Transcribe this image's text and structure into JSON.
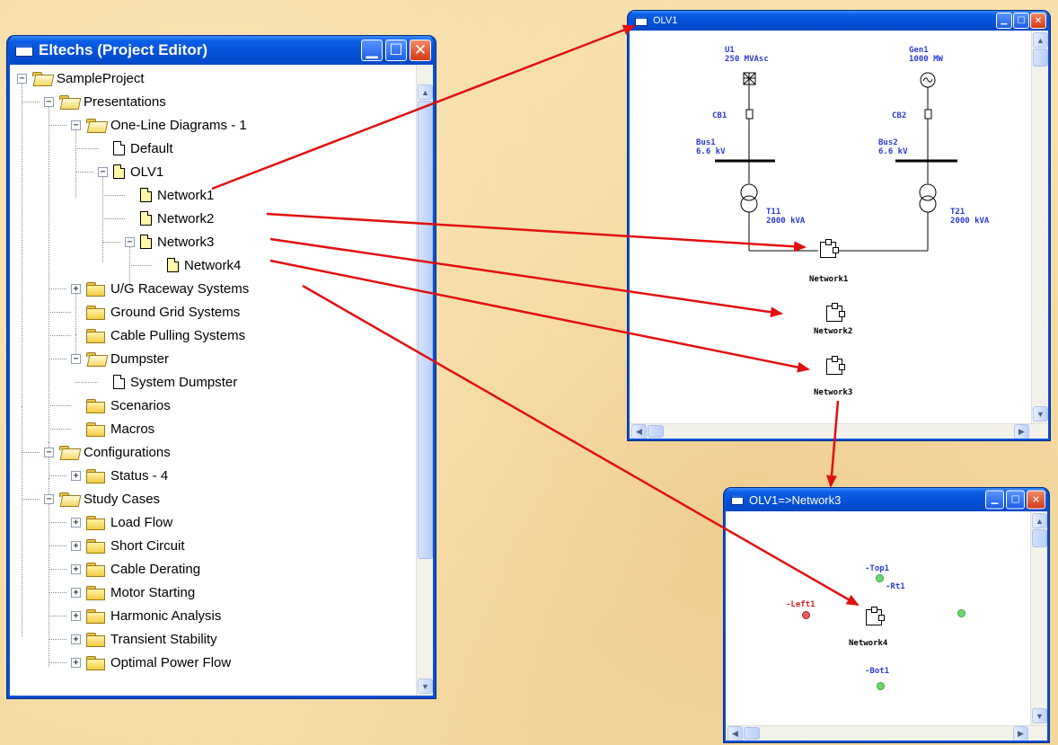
{
  "project_editor": {
    "title": "Eltechs (Project Editor)",
    "tree": [
      {
        "label": "SampleProject",
        "icon": "folder-open-icon",
        "expander": "−"
      },
      {
        "label": "Presentations",
        "icon": "folder-open-icon",
        "expander": "−"
      },
      {
        "label": "One-Line Diagrams - 1",
        "icon": "folder-open-icon",
        "expander": "−"
      },
      {
        "label": "Default",
        "icon": "document-icon",
        "expander": ""
      },
      {
        "label": "OLV1",
        "icon": "document-yellow-icon",
        "expander": "−"
      },
      {
        "label": "Network1",
        "icon": "document-yellow-icon",
        "expander": ""
      },
      {
        "label": "Network2",
        "icon": "document-yellow-icon",
        "expander": ""
      },
      {
        "label": "Network3",
        "icon": "document-yellow-icon",
        "expander": "−"
      },
      {
        "label": "Network4",
        "icon": "document-yellow-icon",
        "expander": ""
      },
      {
        "label": "U/G Raceway Systems",
        "icon": "folder-icon",
        "expander": "+"
      },
      {
        "label": "Ground Grid Systems",
        "icon": "folder-icon",
        "expander": ""
      },
      {
        "label": "Cable Pulling Systems",
        "icon": "folder-icon",
        "expander": ""
      },
      {
        "label": "Dumpster",
        "icon": "folder-open-icon",
        "expander": "−"
      },
      {
        "label": "System Dumpster",
        "icon": "document-icon",
        "expander": ""
      },
      {
        "label": "Scenarios",
        "icon": "folder-icon",
        "expander": ""
      },
      {
        "label": "Macros",
        "icon": "folder-icon",
        "expander": ""
      },
      {
        "label": "Configurations",
        "icon": "folder-open-icon",
        "expander": "−"
      },
      {
        "label": "Status - 4",
        "icon": "folder-icon",
        "expander": "+"
      },
      {
        "label": "Study Cases",
        "icon": "folder-open-icon",
        "expander": "−"
      },
      {
        "label": "Load Flow",
        "icon": "folder-icon",
        "expander": "+"
      },
      {
        "label": "Short Circuit",
        "icon": "folder-icon",
        "expander": "+"
      },
      {
        "label": "Cable Derating",
        "icon": "folder-icon",
        "expander": "+"
      },
      {
        "label": "Motor Starting",
        "icon": "folder-icon",
        "expander": "+"
      },
      {
        "label": "Harmonic Analysis",
        "icon": "folder-icon",
        "expander": "+"
      },
      {
        "label": "Transient Stability",
        "icon": "folder-icon",
        "expander": "+"
      },
      {
        "label": "Optimal Power Flow",
        "icon": "folder-icon",
        "expander": "+"
      }
    ]
  },
  "olv1_window": {
    "title": "OLV1",
    "u1": "U1",
    "u1_rating": "250 MVAsc",
    "gen1": "Gen1",
    "gen1_rating": "1000 MW",
    "cb1": "CB1",
    "cb2": "CB2",
    "bus1": "Bus1",
    "bus1_kv": "6.6 kV",
    "bus2": "Bus2",
    "bus2_kv": "6.6 kV",
    "t11": "T11",
    "t11_rating": "2000 kVA",
    "t21": "T21",
    "t21_rating": "2000 kVA",
    "network1": "Network1",
    "network2": "Network2",
    "network3": "Network3"
  },
  "network3_window": {
    "title": "OLV1=>Network3",
    "top1": "-Top1",
    "rt1": "-Rt1",
    "left1": "-Left1",
    "bot1": "-Bot1",
    "network4": "Network4"
  },
  "colors": {
    "titlebar": "#0450d6",
    "arrow": "#e01010",
    "diagram_text": "#2a3bd4",
    "green_port": "#6fd66f",
    "red_port": "#e06060"
  }
}
